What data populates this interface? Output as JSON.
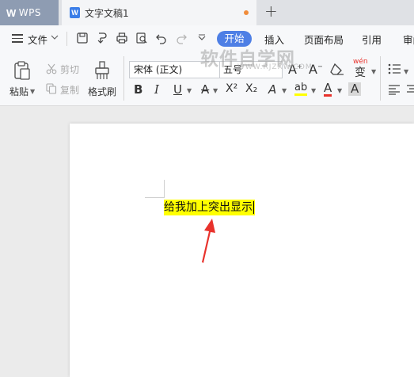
{
  "window": {
    "app_name": "WPS",
    "document_tab": "文字文稿1",
    "new_tab_symbol": "+"
  },
  "menu": {
    "file_label": "文件",
    "tabs": [
      "开始",
      "插入",
      "页面布局",
      "引用",
      "审阅"
    ]
  },
  "ribbon": {
    "paste_label": "粘贴",
    "cut_label": "剪切",
    "copy_label": "复制",
    "format_painter_label": "格式刷",
    "font_name": "宋体 (正文)",
    "font_size": "五号",
    "bold": "B",
    "italic": "I",
    "underline": "U",
    "strikethrough": "A",
    "superscript": "X²",
    "subscript": "X₂",
    "text_effect": "A",
    "highlight": "ab",
    "font_color": "A",
    "char_shading": "A",
    "grow_font": "A",
    "shrink_font": "A",
    "pinyin": "wén",
    "pinyin_char": "变"
  },
  "watermark": {
    "text": "软件自学网",
    "url": "WWW.RJZXW.COM"
  },
  "document": {
    "highlighted_text": "给我加上突出显示"
  },
  "colors": {
    "accent": "#4e7fe5",
    "highlight": "#ffff00",
    "arrow": "#e8322c",
    "unsaved_dot": "#f08c3b"
  }
}
